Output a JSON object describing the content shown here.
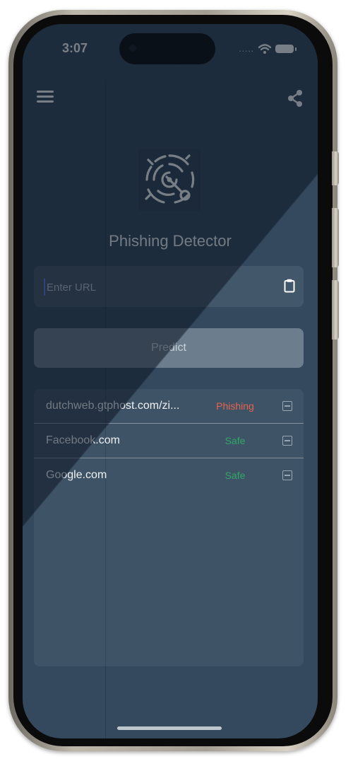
{
  "status_bar": {
    "time": "3:07",
    "signal": "....."
  },
  "app_bar": {
    "menu_icon": "hamburger-menu-icon",
    "share_icon": "share-icon"
  },
  "app": {
    "title": "Phishing Detector",
    "logo_icon": "radar-target-icon"
  },
  "url_input": {
    "placeholder": "Enter URL",
    "value": "",
    "clipboard_icon": "clipboard-icon"
  },
  "predict_button": {
    "label": "Predict"
  },
  "history": [
    {
      "url": "dutchweb.gtphost.com/zi...",
      "status": "Phishing",
      "status_color": "#e4644e"
    },
    {
      "url": "Facebook.com",
      "status": "Safe",
      "status_color": "#2fa866"
    },
    {
      "url": "Google.com",
      "status": "Safe",
      "status_color": "#2fa866"
    }
  ],
  "colors": {
    "background": "#34495e",
    "phishing": "#e4644e",
    "safe": "#2fa866",
    "button": "#6c7d8d"
  }
}
